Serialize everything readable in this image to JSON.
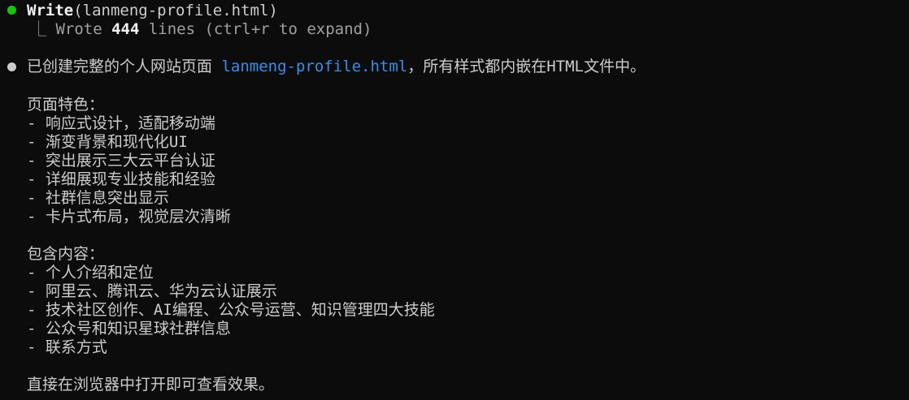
{
  "tool_call": {
    "name": "Write",
    "args": "(lanmeng-profile.html)",
    "result_prefix": "⎿ ",
    "result_text": "Wrote ",
    "result_count": "444",
    "result_suffix": " lines (ctrl+r to expand)"
  },
  "message": {
    "intro_before": "已创建完整的个人网站页面 ",
    "intro_file": "lanmeng-profile.html",
    "intro_after": "，所有样式都内嵌在HTML文件中。",
    "features_heading": "页面特色：",
    "features": [
      "- 响应式设计，适配移动端",
      "- 渐变背景和现代化UI",
      "- 突出展示三大云平台认证",
      "- 详细展现专业技能和经验",
      "- 社群信息突出显示",
      "- 卡片式布局，视觉层次清晰"
    ],
    "contents_heading": "包含内容：",
    "contents": [
      "- 个人介绍和定位",
      "- 阿里云、腾讯云、华为云认证展示",
      "- 技术社区创作、AI编程、公众号运营、知识管理四大技能",
      "- 公众号和知识星球社群信息",
      "- 联系方式"
    ],
    "closing": "直接在浏览器中打开即可查看效果。"
  },
  "colors": {
    "background": "#0c0c0c",
    "text": "#cccccc",
    "tool_bullet": "#16c60c",
    "link": "#3b8eea"
  }
}
